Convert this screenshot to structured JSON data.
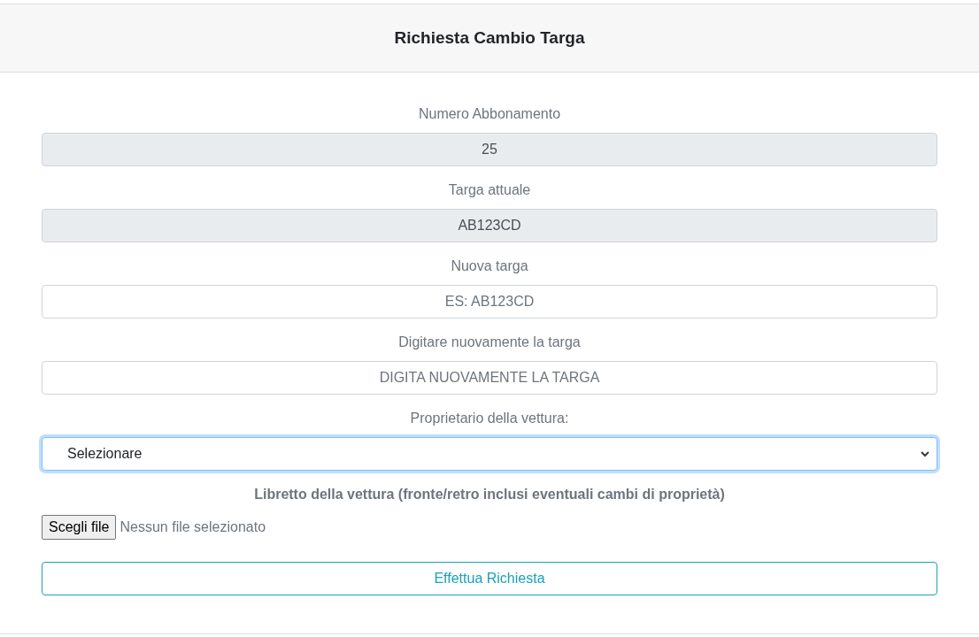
{
  "header": {
    "title": "Richiesta Cambio Targa"
  },
  "fields": [
    {
      "kind": "readonly",
      "label": "Numero Abbonamento",
      "value": "25"
    },
    {
      "kind": "readonly",
      "label": "Targa attuale",
      "value": "AB123CD"
    },
    {
      "kind": "text",
      "label": "Nuova targa",
      "placeholder": "ES: AB123CD"
    },
    {
      "kind": "text",
      "label": "Digitare nuovamente la targa",
      "placeholder": "DIGITA NUOVAMENTE LA TARGA"
    },
    {
      "kind": "select",
      "label": "Proprietario della vettura:",
      "value": "Selezionare",
      "focused": true
    }
  ],
  "upload": {
    "label": "Libretto della vettura (fronte/retro inclusi eventuali cambi di proprietà)",
    "button": "Scegli file",
    "status": "Nessun file selezionato"
  },
  "submit": {
    "label": "Effettua Richiesta"
  }
}
